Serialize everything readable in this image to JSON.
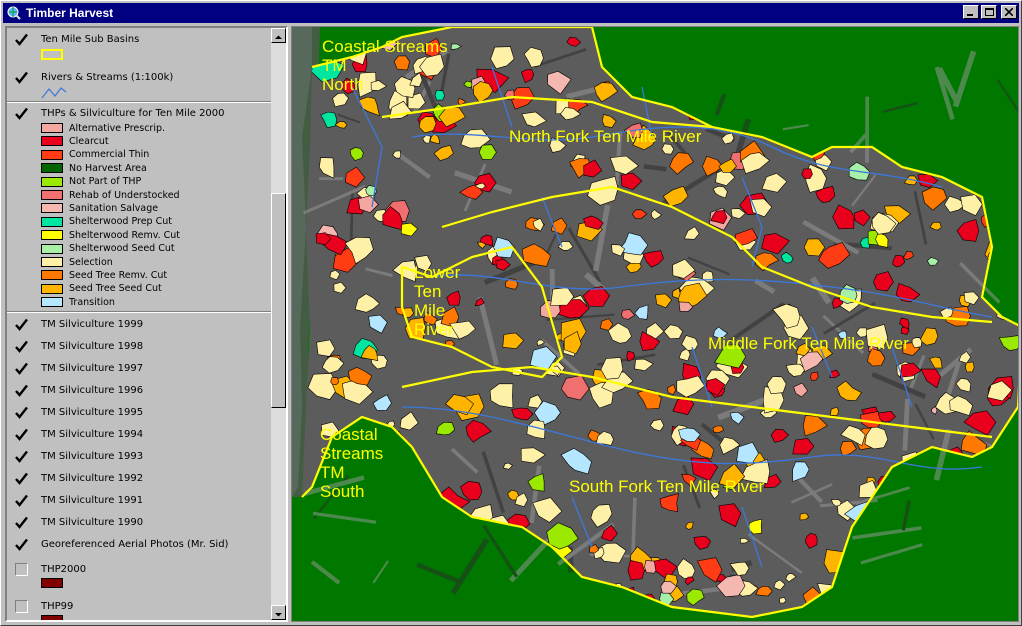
{
  "window": {
    "title": "Timber Harvest"
  },
  "toc": {
    "layers_top": [
      {
        "name": "Ten Mile Sub Basins",
        "checked": true
      },
      {
        "name": "Rivers & Streams (1:100k)",
        "checked": true
      },
      {
        "name": "THPs & Silviculture for Ten Mile 2000",
        "checked": true
      }
    ],
    "legend": [
      {
        "label": "Alternative Prescrip.",
        "color": "#f4a6a0"
      },
      {
        "label": "Clearcut",
        "color": "#e8001c"
      },
      {
        "label": "Commercial Thin",
        "color": "#ff3c14"
      },
      {
        "label": "No Harvest Area",
        "color": "#006400"
      },
      {
        "label": "Not Part of THP",
        "color": "#9be800"
      },
      {
        "label": "Rehab of Understocked",
        "color": "#f07070"
      },
      {
        "label": "Sanitation Salvage",
        "color": "#f4b8b0"
      },
      {
        "label": "Shelterwood Prep Cut",
        "color": "#00e6a0"
      },
      {
        "label": "Shelterwood Remv. Cut",
        "color": "#ffff00"
      },
      {
        "label": "Shelterwood Seed Cut",
        "color": "#a8f0a8"
      },
      {
        "label": "Selection",
        "color": "#fff0a8"
      },
      {
        "label": "Seed Tree Remv. Cut",
        "color": "#ff7800"
      },
      {
        "label": "Seed Tree Seed Cut",
        "color": "#ffb400"
      },
      {
        "label": "Transition",
        "color": "#b4e6ff"
      }
    ],
    "layers_bottom": [
      {
        "name": "TM Silviculture 1999",
        "checked": true
      },
      {
        "name": "TM Silviculture 1998",
        "checked": true
      },
      {
        "name": "TM Silviculture 1997",
        "checked": true
      },
      {
        "name": "TM Silviculture 1996",
        "checked": true
      },
      {
        "name": "TM Silviculture 1995",
        "checked": true
      },
      {
        "name": "TM Silviculture 1994",
        "checked": true
      },
      {
        "name": "TM Silviculture 1993",
        "checked": true
      },
      {
        "name": "TM Silviculture 1992",
        "checked": true
      },
      {
        "name": "TM Silviculture 1991",
        "checked": true
      },
      {
        "name": "TM Silviculture 1990",
        "checked": true
      },
      {
        "name": "Georeferenced Aerial Photos (Mr. Sid)",
        "checked": true
      },
      {
        "name": "THP2000",
        "checked": false,
        "swatch": "#800000"
      },
      {
        "name": "THP99",
        "checked": false,
        "swatch": "#800000"
      }
    ]
  },
  "map": {
    "labels": [
      {
        "text": "Coastal Streams\nTM\nNorth"
      },
      {
        "text": "North Fork Ten Mile River"
      },
      {
        "text": "Lower\nTen\nMile\nRiver"
      },
      {
        "text": "Middle Fork Ten Mile River"
      },
      {
        "text": "Coastal\nStreams\nTM\nSouth"
      },
      {
        "text": "South Fork Ten Mile River"
      }
    ],
    "colors": {
      "background": "#007800",
      "basin_outline": "#ffff00",
      "rivers": "#3c78dc",
      "terrain": "#505050",
      "ocean": "#c8f0ff"
    }
  }
}
